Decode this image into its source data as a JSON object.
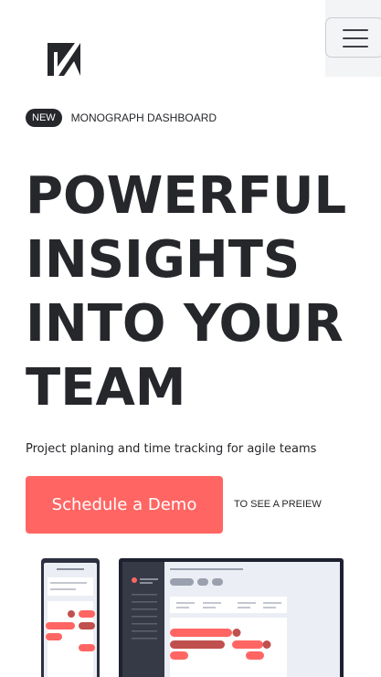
{
  "header": {
    "logo_icon": "k-logo-icon",
    "menu_icon": "hamburger-menu-icon"
  },
  "badge": {
    "label": "NEW",
    "text": "MONOGRAPH DASHBOARD"
  },
  "hero": {
    "title_lines": [
      "POWERFUL",
      "INSIGHTS",
      "INTO YOUR",
      "TEAM"
    ],
    "subtitle": "Project planing and time tracking for agile teams"
  },
  "cta": {
    "button_label": "Schedule a Demo",
    "note": "TO SEE A PREIEW"
  },
  "colors": {
    "text": "#25272b",
    "accent": "#ff6663",
    "accent_dark": "#c0504e",
    "device_frame": "#2c3040",
    "screen_bg": "#eceef5"
  }
}
